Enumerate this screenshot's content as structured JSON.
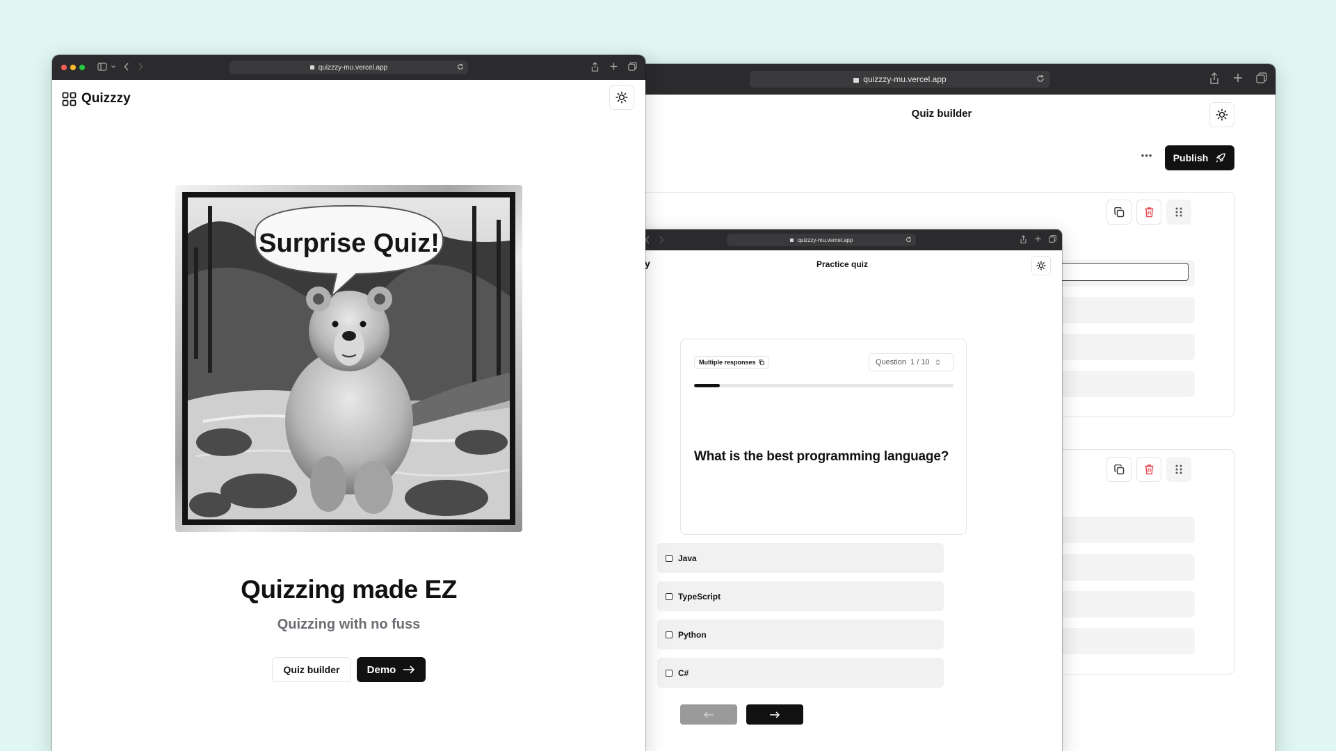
{
  "colors": {
    "background": "#dff6f1",
    "titlebar": "#2b2b2d",
    "primary": "#111111",
    "danger": "#e5484d",
    "muted": "#f1f1f2"
  },
  "builder_window": {
    "url": "quizzzy-mu.vercel.app",
    "page_title": "Quiz builder",
    "more_label": "•••",
    "publish_label": "Publish"
  },
  "practice_window": {
    "url": "quizzzy-mu.vercel.app",
    "left_fragment": "y",
    "page_title": "Practice quiz",
    "badge_label": "Multiple responses",
    "question_label": "Question",
    "question_counter": "1 / 10",
    "progress": 0.1,
    "question_text": "What is the best programming language?",
    "answers": [
      "Java",
      "TypeScript",
      "Python",
      "C#"
    ],
    "prev_icon": "arrow-left-icon",
    "next_icon": "arrow-right-icon"
  },
  "home_window": {
    "url": "quizzzy-mu.vercel.app",
    "brand": "Quizzzy",
    "hero_image_caption": "Surprise Quiz!",
    "headline": "Quizzing made EZ",
    "subheadline": "Quizzing with no fuss",
    "quiz_builder_button": "Quiz builder",
    "demo_button": "Demo"
  }
}
